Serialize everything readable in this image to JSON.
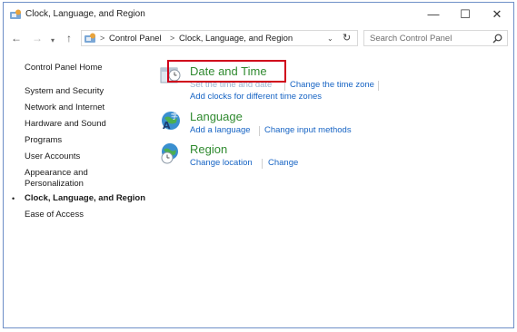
{
  "window": {
    "title": "Clock, Language, and Region",
    "controls": {
      "minimize": "—",
      "maximize": "☐",
      "close": "✕"
    }
  },
  "navigation": {
    "back": "←",
    "forward": "→",
    "recent": "▾",
    "up": "↑",
    "breadcrumb": [
      "Control Panel",
      "Clock, Language, and Region"
    ],
    "separator": ">",
    "dropdown": "⌄",
    "refresh": "↻"
  },
  "search": {
    "placeholder": "Search Control Panel"
  },
  "sidebar": {
    "items": [
      {
        "label": "Control Panel Home"
      },
      {
        "label": "System and Security"
      },
      {
        "label": "Network and Internet"
      },
      {
        "label": "Hardware and Sound"
      },
      {
        "label": "Programs"
      },
      {
        "label": "User Accounts"
      },
      {
        "label": "Appearance and"
      },
      {
        "label": "Personalization"
      },
      {
        "label": "Clock, Language, and Region",
        "current": true
      },
      {
        "label": "Ease of Access"
      }
    ],
    "bullet": "•"
  },
  "categories": [
    {
      "title": "Date and Time",
      "icon": "clock-calendar-icon",
      "links": [
        "Set the time and date",
        "Change the time zone",
        "Add clocks for different time zones"
      ]
    },
    {
      "title": "Language",
      "icon": "language-globe-icon",
      "links": [
        "Add a language",
        "Change input methods"
      ]
    },
    {
      "title": "Region",
      "icon": "region-globe-clock-icon",
      "links": [
        "Change location",
        "Change"
      ]
    }
  ],
  "colors": {
    "category_title": "#2f8a2f",
    "link": "#1764c4",
    "highlight": "#d0021b"
  }
}
